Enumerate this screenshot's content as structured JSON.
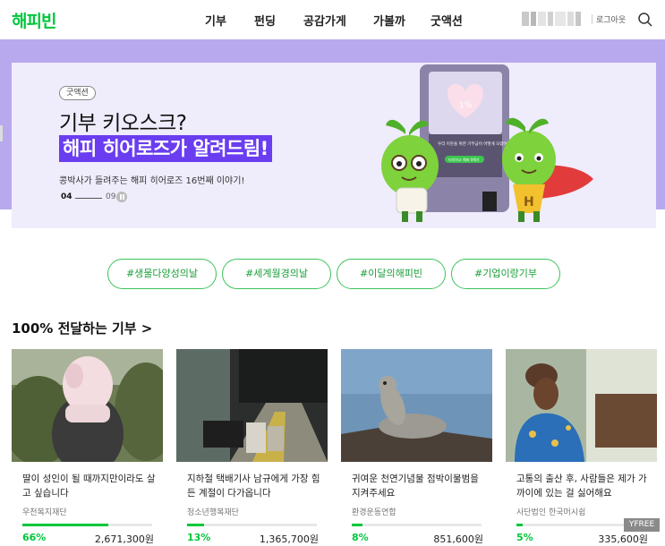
{
  "header": {
    "logo": "해피빈",
    "nav": [
      "기부",
      "펀딩",
      "공감가게",
      "가볼까",
      "굿액션"
    ],
    "logout": "로그아웃"
  },
  "banner": {
    "tag": "굿액션",
    "title_line1": "기부 키오스크?",
    "title_line2": "해피 히어로즈가 알려드림!",
    "subtitle": "콩박사가 들려주는 해피 히어로즈 16번째 이야기!",
    "page_current": "04",
    "page_total": "09",
    "screen_text": "우리 이웃을 위한 기부금이 어떻게 모였어요",
    "screen_percent": "1%",
    "screen_button": "터치하고 해봐 0해기"
  },
  "hashtags": [
    "#생물다양성의날",
    "#세계월경의날",
    "#이달의해피빈",
    "#기업이랑기부"
  ],
  "section": {
    "title": "100% 전달하는 기부 >"
  },
  "cards": [
    {
      "title": "딸이 성인이 될 때까지만이라도 살고 싶습니다",
      "org": "우천복지재단",
      "percent": "66%",
      "progress": 0.66,
      "amount": "2,671,300원"
    },
    {
      "title": "지하철 택배기사 남규에게 가장 힘든 계절이 다가옵니다",
      "org": "청소년행복재단",
      "percent": "13%",
      "progress": 0.13,
      "amount": "1,365,700원"
    },
    {
      "title": "귀여운 천연기념물 점박이물범을 지켜주세요",
      "org": "환경운동연합",
      "percent": "8%",
      "progress": 0.08,
      "amount": "851,600원"
    },
    {
      "title": "고통의 출산 후, 사람들은 제가 가까이에 있는 걸 싫어해요",
      "org": "사단법인 한국머시쉽",
      "percent": "5%",
      "progress": 0.05,
      "amount": "335,600원"
    }
  ],
  "watermark": "YFREE",
  "colors": {
    "brand": "#00c73c",
    "banner_bg": "#b8a8ee",
    "highlight": "#6a3df0"
  },
  "icons": [
    "search-icon",
    "pause-icon",
    "chevron-right-icon"
  ]
}
